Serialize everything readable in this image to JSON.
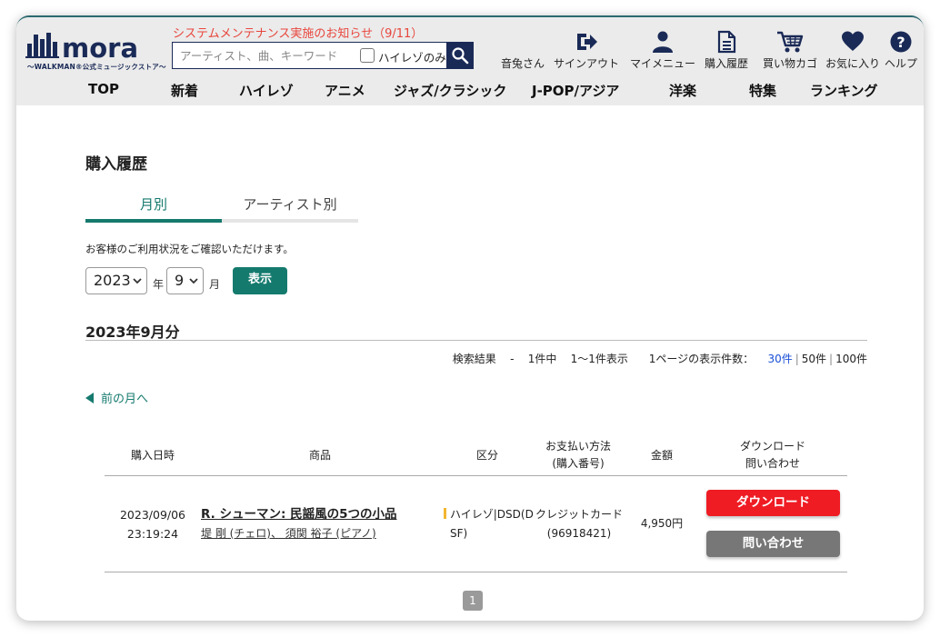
{
  "header": {
    "logo_text": "mora",
    "logo_tagline": "〜WALKMAN®公式ミュージックストア〜",
    "notice": "システムメンテナンス実施のお知らせ（9/11）",
    "search": {
      "placeholder": "アーティスト、曲、キーワード",
      "value": "",
      "hires_only_label": "ハイレゾのみ"
    },
    "user_name": "音兔さん",
    "nav_items": [
      {
        "label": "サインアウト",
        "icon": "sign-out-icon"
      },
      {
        "label": "マイメニュー",
        "icon": "user-icon"
      },
      {
        "label": "購入履歴",
        "icon": "document-icon"
      },
      {
        "label": "買い物カゴ",
        "icon": "cart-icon"
      },
      {
        "label": "お気に入り",
        "icon": "heart-icon"
      },
      {
        "label": "ヘルプ",
        "icon": "help-icon"
      }
    ],
    "global_nav": [
      "TOP",
      "新着",
      "ハイレゾ",
      "アニメ",
      "ジャズ/クラシック",
      "J-POP/アジア",
      "洋楽",
      "特集",
      "ランキング"
    ]
  },
  "page": {
    "title": "購入履歴",
    "tabs": [
      {
        "label": "月別",
        "active": true
      },
      {
        "label": "アーティスト別",
        "active": false
      }
    ],
    "description": "お客様のご利用状況をご確認いただけます。",
    "filter": {
      "year": "2023",
      "year_unit": "年",
      "month": "9",
      "month_unit": "月",
      "show_label": "表示"
    },
    "section_title": "2023年9月分",
    "results": {
      "label": "検索結果",
      "dash": "-",
      "count_text": "1件中",
      "range_text": "1〜1件表示",
      "per_page_label": "1ページの表示件数：",
      "per_page_options": [
        "30件",
        "50件",
        "100件"
      ],
      "current_per_page": "30件"
    },
    "prev_month_label": "前の月へ",
    "table": {
      "headers": {
        "date": "購入日時",
        "product": "商品",
        "category": "区分",
        "payment_line1": "お支払い方法",
        "payment_line2": "(購入番号)",
        "amount": "金額",
        "actions_line1": "ダウンロード",
        "actions_line2": "問い合わせ"
      },
      "rows": [
        {
          "date": "2023/09/06",
          "time": "23:19:24",
          "title": "R. シューマン: 民謡風の5つの小品",
          "artists": "堤 剛 (チェロ)、 須関 裕子 (ピアノ)",
          "category_line1": "ハイレゾ|DSD(D",
          "category_line2": "SF)",
          "payment": "クレジットカード",
          "order_no": "(96918421)",
          "amount": "4,950円",
          "download_label": "ダウンロード",
          "inquiry_label": "問い合わせ"
        }
      ]
    },
    "pagination": {
      "current": "1"
    }
  },
  "colors": {
    "accent": "#157a6e",
    "brand_navy": "#1a2a57",
    "notice": "#e8463d",
    "download": "#ef1c24",
    "inquiry": "#777777"
  }
}
